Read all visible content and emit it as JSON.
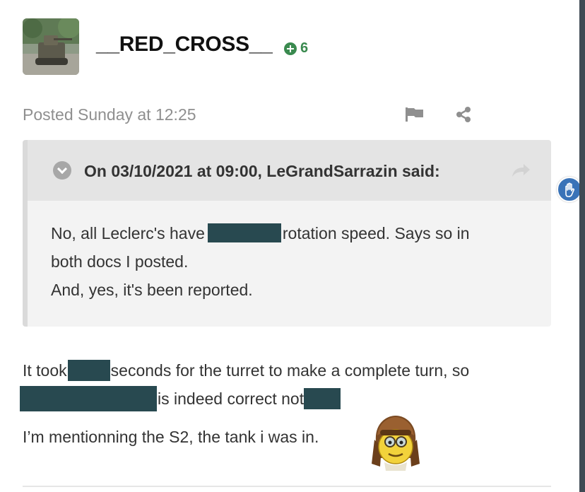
{
  "post": {
    "username": "__RED_CROSS__",
    "reputation": "6",
    "posted": "Posted Sunday at 12:25"
  },
  "quote": {
    "cite": "On 03/10/2021 at 09:00, LeGrandSarrazin said:",
    "line1_a": "No, all Leclerc's have",
    "line1_b": "rotation speed. Says so in",
    "line2": "both docs I posted.",
    "line3": "And, yes, it's been reported."
  },
  "body": {
    "line1_a": "It took",
    "line1_b": "seconds for the turret to make a complete turn, so",
    "line2_a": "is indeed correct not",
    "line3": "I’m mentionning the S2, the tank i was in."
  },
  "colors": {
    "redaction": "#284950",
    "reputation": "#3a8a4f",
    "accent": "#3a73b8"
  },
  "icons": [
    "avatar",
    "reputation-plus-icon",
    "report-flag-icon",
    "share-icon",
    "chevron-down-icon",
    "reply-arrow-icon",
    "grab-hand-icon",
    "aviator-emoji-icon"
  ]
}
